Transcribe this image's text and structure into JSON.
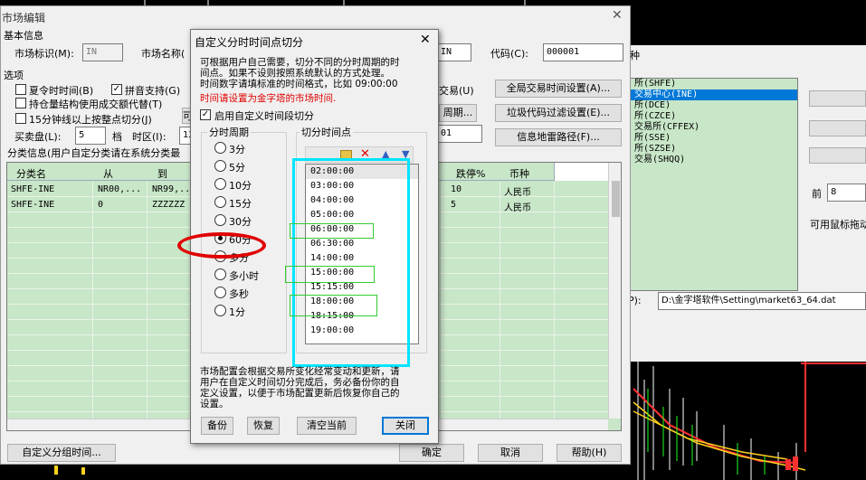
{
  "main": {
    "title": "市场编辑",
    "close_glyph": "✕",
    "section_basic": "基本信息",
    "market_id_label": "市场标识(M):",
    "market_id_value": "IN",
    "market_name_label": "市场名称(",
    "field_in_value": "IN",
    "code_label": "代码(C):",
    "code_value": "000001",
    "hidden_label_zhong": "种",
    "options_label": "选项",
    "cb_summer": "夏令时时间(B)",
    "cb_pinyin": "拼音支持(G)",
    "cb_hold": "持仓量结构使用成交额代替(T)",
    "cb_15min": "15分钟线以上按整点切分(J)",
    "cb_hidden_mark": "可",
    "trade_label_frag": "交易(U)",
    "global_trade_btn": "全局交易时间设置(A)...",
    "cycle_btn_frag": "周期...",
    "garbage_btn": "垃圾代码过滤设置(E)...",
    "field_01": "01",
    "info_mine_btn": "信息地雷路径(F)...",
    "buy_sell_label": "买卖盘(L):",
    "buy_sell_value": "5",
    "dang_label": "档",
    "tz_label": "时区(I):",
    "tz_value": "12",
    "classify_label": "分类信息(用户自定分类请在系统分类最",
    "table_headers": [
      "分类名",
      "从",
      "到",
      "",
      "跌停%",
      "币种"
    ],
    "table_rows": [
      {
        "name": "SHFE-INE",
        "from": "NR00,...",
        "to": "NR99,...",
        "down": "10",
        "currency": "人民币"
      },
      {
        "name": "SHFE-INE",
        "from": "0",
        "to": "ZZZZZZ",
        "down": "5",
        "currency": "人民币"
      }
    ],
    "custom_group_btn": "自定义分组时间...",
    "ok_btn": "确定",
    "cancel_btn": "取消",
    "help_btn": "帮助(H)"
  },
  "right_panel": {
    "exchanges": [
      "所(SHFE)",
      "交易中心(INE)",
      "所(DCE)",
      "所(CZCE)",
      "交易所(CFFEX)",
      "所(SSE)",
      "所(SZSE)",
      "交易(SHQQ)"
    ],
    "selected_index": 1,
    "qian_label": "前",
    "qian_value": "8",
    "drag_hint": "可用鼠标拖动",
    "path_label": "P):",
    "path_value": "D:\\金字塔软件\\Setting\\market63_64.dat"
  },
  "dialog": {
    "title": "自定义分时时间点切分",
    "close_glyph": "✕",
    "desc_line1": "可根据用户自己需要，切分不同的分时周期的时",
    "desc_line2": "间点。如果不设则按照系统默认的方式处理。",
    "desc_line3": "时间数字请填标准的时间格式，比如 09:00:00",
    "warning": "时间请设置为金字塔的市场时间.",
    "enable_label": "启用自定义时间段切分",
    "enable_checked": "✓",
    "period_group": "分时周期",
    "periods": [
      "3分",
      "5分",
      "10分",
      "15分",
      "30分",
      "60分",
      "多分",
      "多小时",
      "多秒",
      "1分"
    ],
    "selected_period": "60分",
    "cut_group": "切分时间点",
    "times": [
      "02:00:00",
      "03:00:00",
      "04:00:00",
      "05:00:00",
      "06:00:00",
      "06:30:00",
      "14:00:00",
      "15:00:00",
      "15:15:00",
      "18:00:00",
      "18:15:00",
      "19:00:00"
    ],
    "bottom_line1": "市场配置会根据交易所变化经常变动和更新，请",
    "bottom_line2": "用户在自定义时间切分完成后，务必备份你的自",
    "bottom_line3": "定义设置，以便于市场配置更新后恢复你自己的",
    "bottom_line4": "设置。",
    "backup_btn": "备份",
    "restore_btn": "恢复",
    "clear_btn": "清空当前",
    "close_btn": "关闭"
  },
  "colors": {
    "dialog_bg": "#f0f0f0",
    "grid_green": "#c8e6c8",
    "warning_red": "#e00000",
    "annotation_red": "#e00000",
    "annotation_cyan": "#00e5ff",
    "annotation_green": "#33cc33",
    "selection_blue": "#0078d7"
  }
}
